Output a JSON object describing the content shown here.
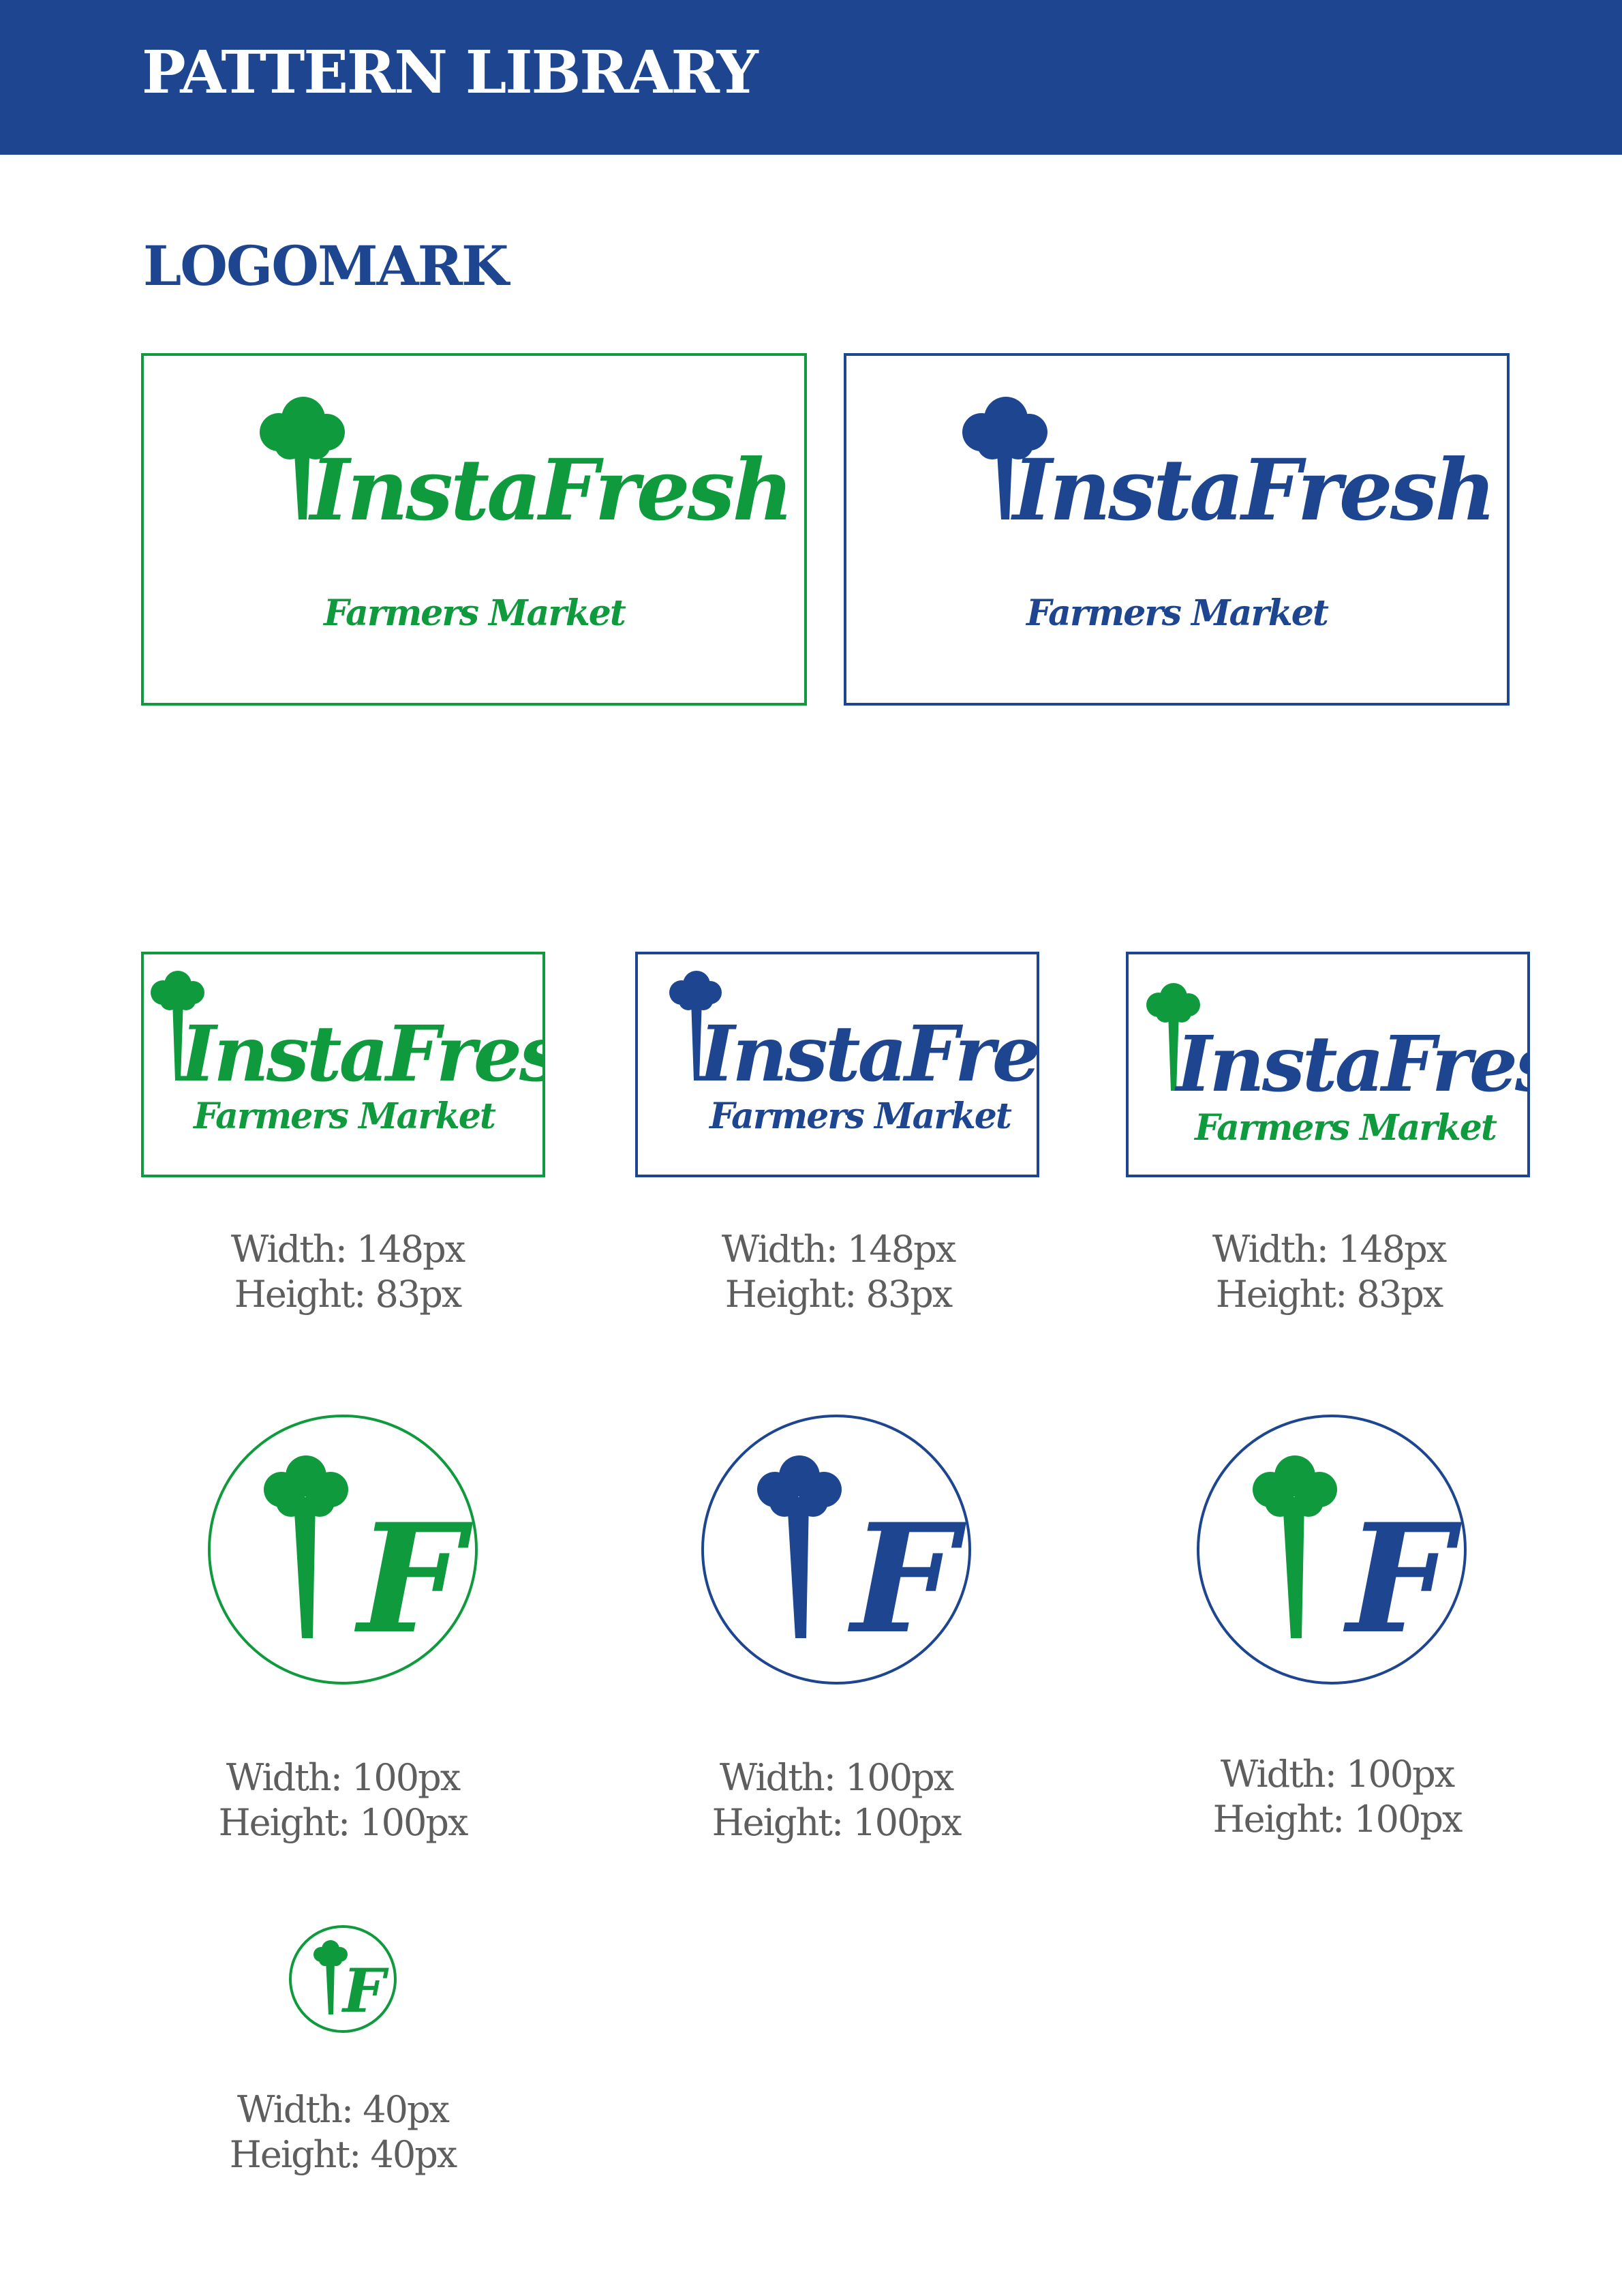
{
  "header": {
    "title": "PATTERN LIBRARY"
  },
  "section": {
    "title": "LOGOMARK"
  },
  "colors": {
    "brand_blue": "#1d4590",
    "brand_green": "#0f9a3e",
    "caption_gray": "#5e5e5e",
    "background": "#ffffff"
  },
  "brand": {
    "name": "InstaFresh",
    "tagline": "Farmers Market",
    "monogram": "IF"
  },
  "large_logos": [
    {
      "variant": "green"
    },
    {
      "variant": "blue"
    }
  ],
  "small_logos": [
    {
      "variant": "green",
      "width": "Width: 148px",
      "height": "Height: 83px"
    },
    {
      "variant": "blue",
      "width": "Width: 148px",
      "height": "Height: 83px"
    },
    {
      "variant": "mixed",
      "width": "Width: 148px",
      "height": "Height: 83px"
    }
  ],
  "icons": [
    {
      "variant": "green",
      "width": "Width: 100px",
      "height": "Height: 100px"
    },
    {
      "variant": "blue",
      "width": "Width: 100px",
      "height": "Height: 100px"
    },
    {
      "variant": "mixed",
      "width": "Width: 100px",
      "height": "Height: 100px"
    }
  ],
  "small_icon": {
    "variant": "green",
    "width": "Width: 40px",
    "height": "Height: 40px"
  }
}
